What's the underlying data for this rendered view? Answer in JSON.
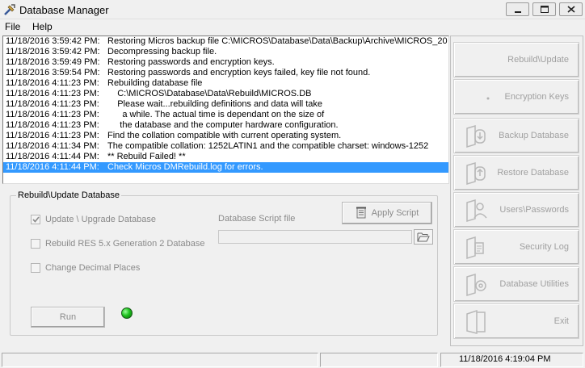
{
  "window": {
    "title": "Database Manager",
    "icon": "tools-icon"
  },
  "menu": {
    "items": [
      "File",
      "Help"
    ]
  },
  "log": {
    "lines": [
      {
        "time": "11/18/2016 3:59:42 PM:",
        "message": "Restoring Micros backup file C:\\MICROS\\Database\\Data\\Backup\\Archive\\MICROS_20"
      },
      {
        "time": "11/18/2016 3:59:42 PM:",
        "message": "Decompressing backup file."
      },
      {
        "time": "11/18/2016 3:59:49 PM:",
        "message": "Restoring passwords and encryption keys."
      },
      {
        "time": "11/18/2016 3:59:54 PM:",
        "message": "Restoring passwords and encryption keys failed, key file not found."
      },
      {
        "time": "11/18/2016 4:11:23 PM:",
        "message": "Rebuilding database file"
      },
      {
        "time": "11/18/2016 4:11:23 PM:",
        "message": "    C:\\MICROS\\Database\\Data\\Rebuild\\MICROS.DB"
      },
      {
        "time": "11/18/2016 4:11:23 PM:",
        "message": "    Please wait...rebuilding definitions and data will take"
      },
      {
        "time": "11/18/2016 4:11:23 PM:",
        "message": "      a while. The actual time is dependant on the size of"
      },
      {
        "time": "11/18/2016 4:11:23 PM:",
        "message": "     the database and the computer hardware configuration."
      },
      {
        "time": "11/18/2016 4:11:23 PM:",
        "message": "Find the collation compatible with current operating system."
      },
      {
        "time": "11/18/2016 4:11:34 PM:",
        "message": "The compatible collation: 1252LATIN1 and the compatible charset: windows-1252"
      },
      {
        "time": "11/18/2016 4:11:44 PM:",
        "message": "** Rebuild Failed! **"
      },
      {
        "time": "11/18/2016 4:11:44 PM:",
        "message": "Check Micros DMRebuild.log for errors.",
        "selected": true
      }
    ]
  },
  "rebuild_group": {
    "title": "Rebuild\\Update Database",
    "options": [
      {
        "label": "Update \\ Upgrade Database",
        "checked": true
      },
      {
        "label": "Rebuild RES 5.x Generation 2 Database",
        "checked": false
      },
      {
        "label": "Change Decimal Places",
        "checked": false
      }
    ],
    "script_label": "Database Script file",
    "script_value": "",
    "apply_label": "Apply Script",
    "run_label": "Run",
    "status_color": "#1ec21e"
  },
  "sidebar": {
    "buttons": [
      {
        "label": "Rebuild\\Update",
        "icon": "rebuild-icon"
      },
      {
        "label": "Encryption Keys",
        "icon": "key-icon"
      },
      {
        "label": "Backup Database",
        "icon": "backup-icon"
      },
      {
        "label": "Restore Database",
        "icon": "restore-icon"
      },
      {
        "label": "Users\\Passwords",
        "icon": "users-icon"
      },
      {
        "label": "Security Log",
        "icon": "log-icon"
      },
      {
        "label": "Database Utilities",
        "icon": "utilities-icon"
      },
      {
        "label": "Exit",
        "icon": "exit-door-icon"
      }
    ]
  },
  "statusbar": {
    "datetime": "11/18/2016 4:19:04 PM"
  },
  "colors": {
    "selection": "#3399ff",
    "disabled_text": "#8a8a8a",
    "led": "#1ec21e"
  }
}
